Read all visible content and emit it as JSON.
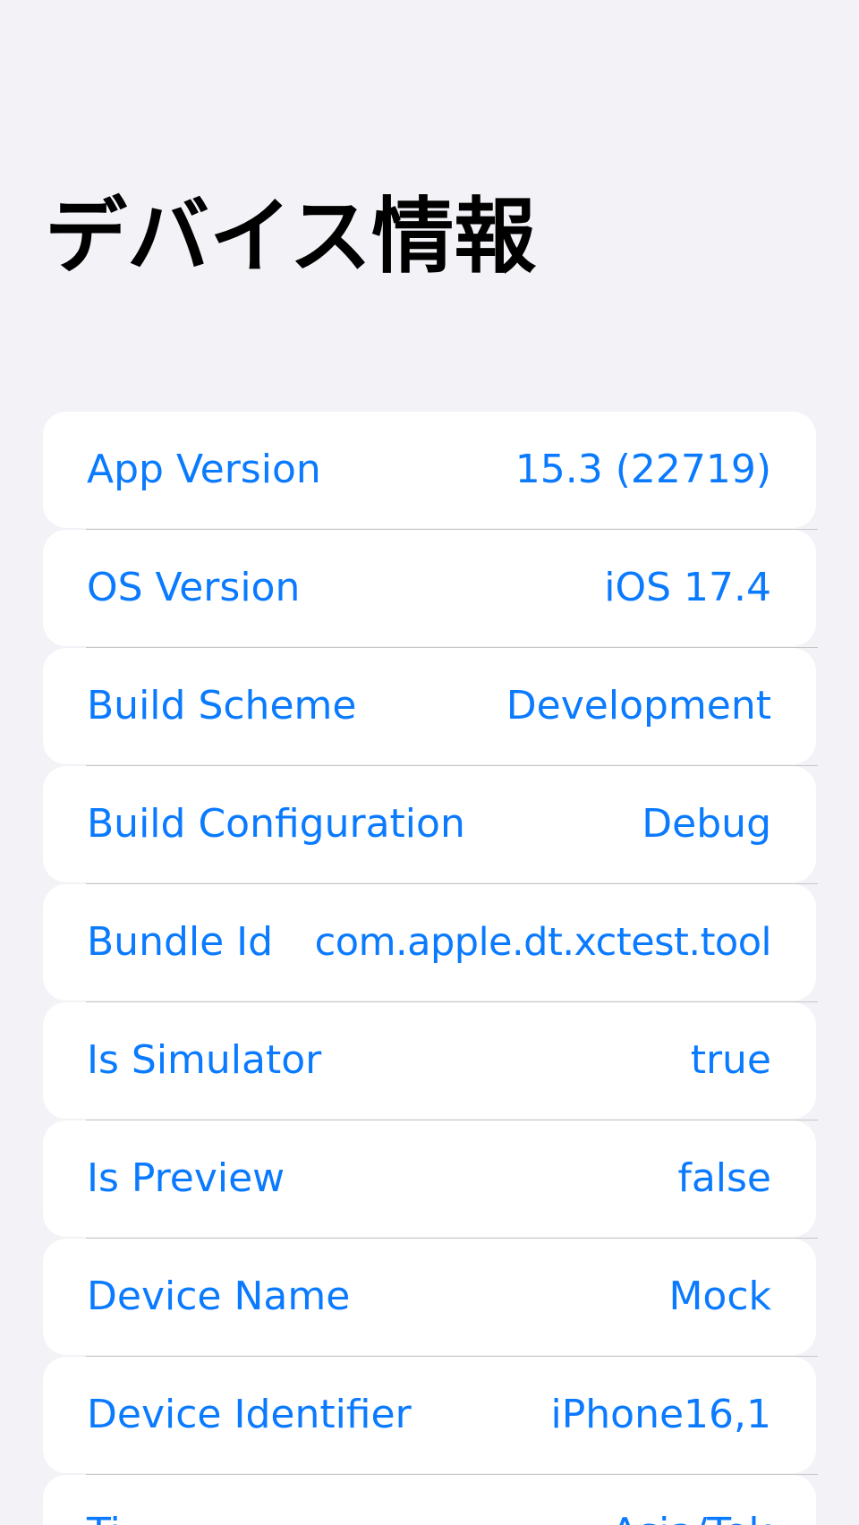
{
  "page": {
    "title": "デバイス情報"
  },
  "colors": {
    "background": "#f2f2f7",
    "card": "#ffffff",
    "accent": "#0a7aff",
    "separator": "#c6c6c8"
  },
  "rows": [
    {
      "label": "App Version",
      "value": "15.3 (22719)"
    },
    {
      "label": "OS Version",
      "value": "iOS 17.4"
    },
    {
      "label": "Build Scheme",
      "value": "Development"
    },
    {
      "label": "Build Configuration",
      "value": "Debug"
    },
    {
      "label": "Bundle Id",
      "value": "com.apple.dt.xctest.tool"
    },
    {
      "label": "Is Simulator",
      "value": "true"
    },
    {
      "label": "Is Preview",
      "value": "false"
    },
    {
      "label": "Device Name",
      "value": "Mock"
    },
    {
      "label": "Device Identifier",
      "value": "iPhone16,1"
    },
    {
      "label": "Ti",
      "value": "Asia/Tok"
    }
  ]
}
